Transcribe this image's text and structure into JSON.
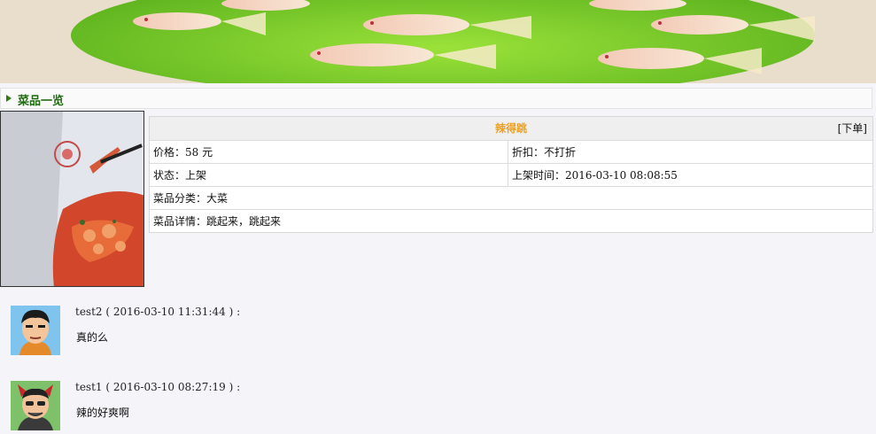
{
  "section": {
    "title": "菜品一览"
  },
  "dish": {
    "name": "辣得跳",
    "order_label": "[下单]",
    "price": {
      "label": "价格",
      "value": "58 元"
    },
    "discount": {
      "label": "折扣",
      "value": "不打折"
    },
    "status": {
      "label": "状态",
      "value": "上架"
    },
    "listed_time": {
      "label": "上架时间",
      "value": "2016-03-10 08:08:55"
    },
    "category": {
      "label": "菜品分类",
      "value": "大菜"
    },
    "detail": {
      "label": "菜品详情",
      "value": "跳起来，跳起来"
    },
    "separator": "："
  },
  "comments": [
    {
      "user": "test2",
      "time": "2016-03-10 11:31:44",
      "text": "真的么",
      "avatar": "cartoon-boy-avatar"
    },
    {
      "user": "test1",
      "time": "2016-03-10 08:27:19",
      "text": "辣的好爽啊",
      "avatar": "cartoon-devil-avatar"
    }
  ],
  "colors": {
    "accent_green": "#1f6a12",
    "dish_name": "#f0a020"
  }
}
